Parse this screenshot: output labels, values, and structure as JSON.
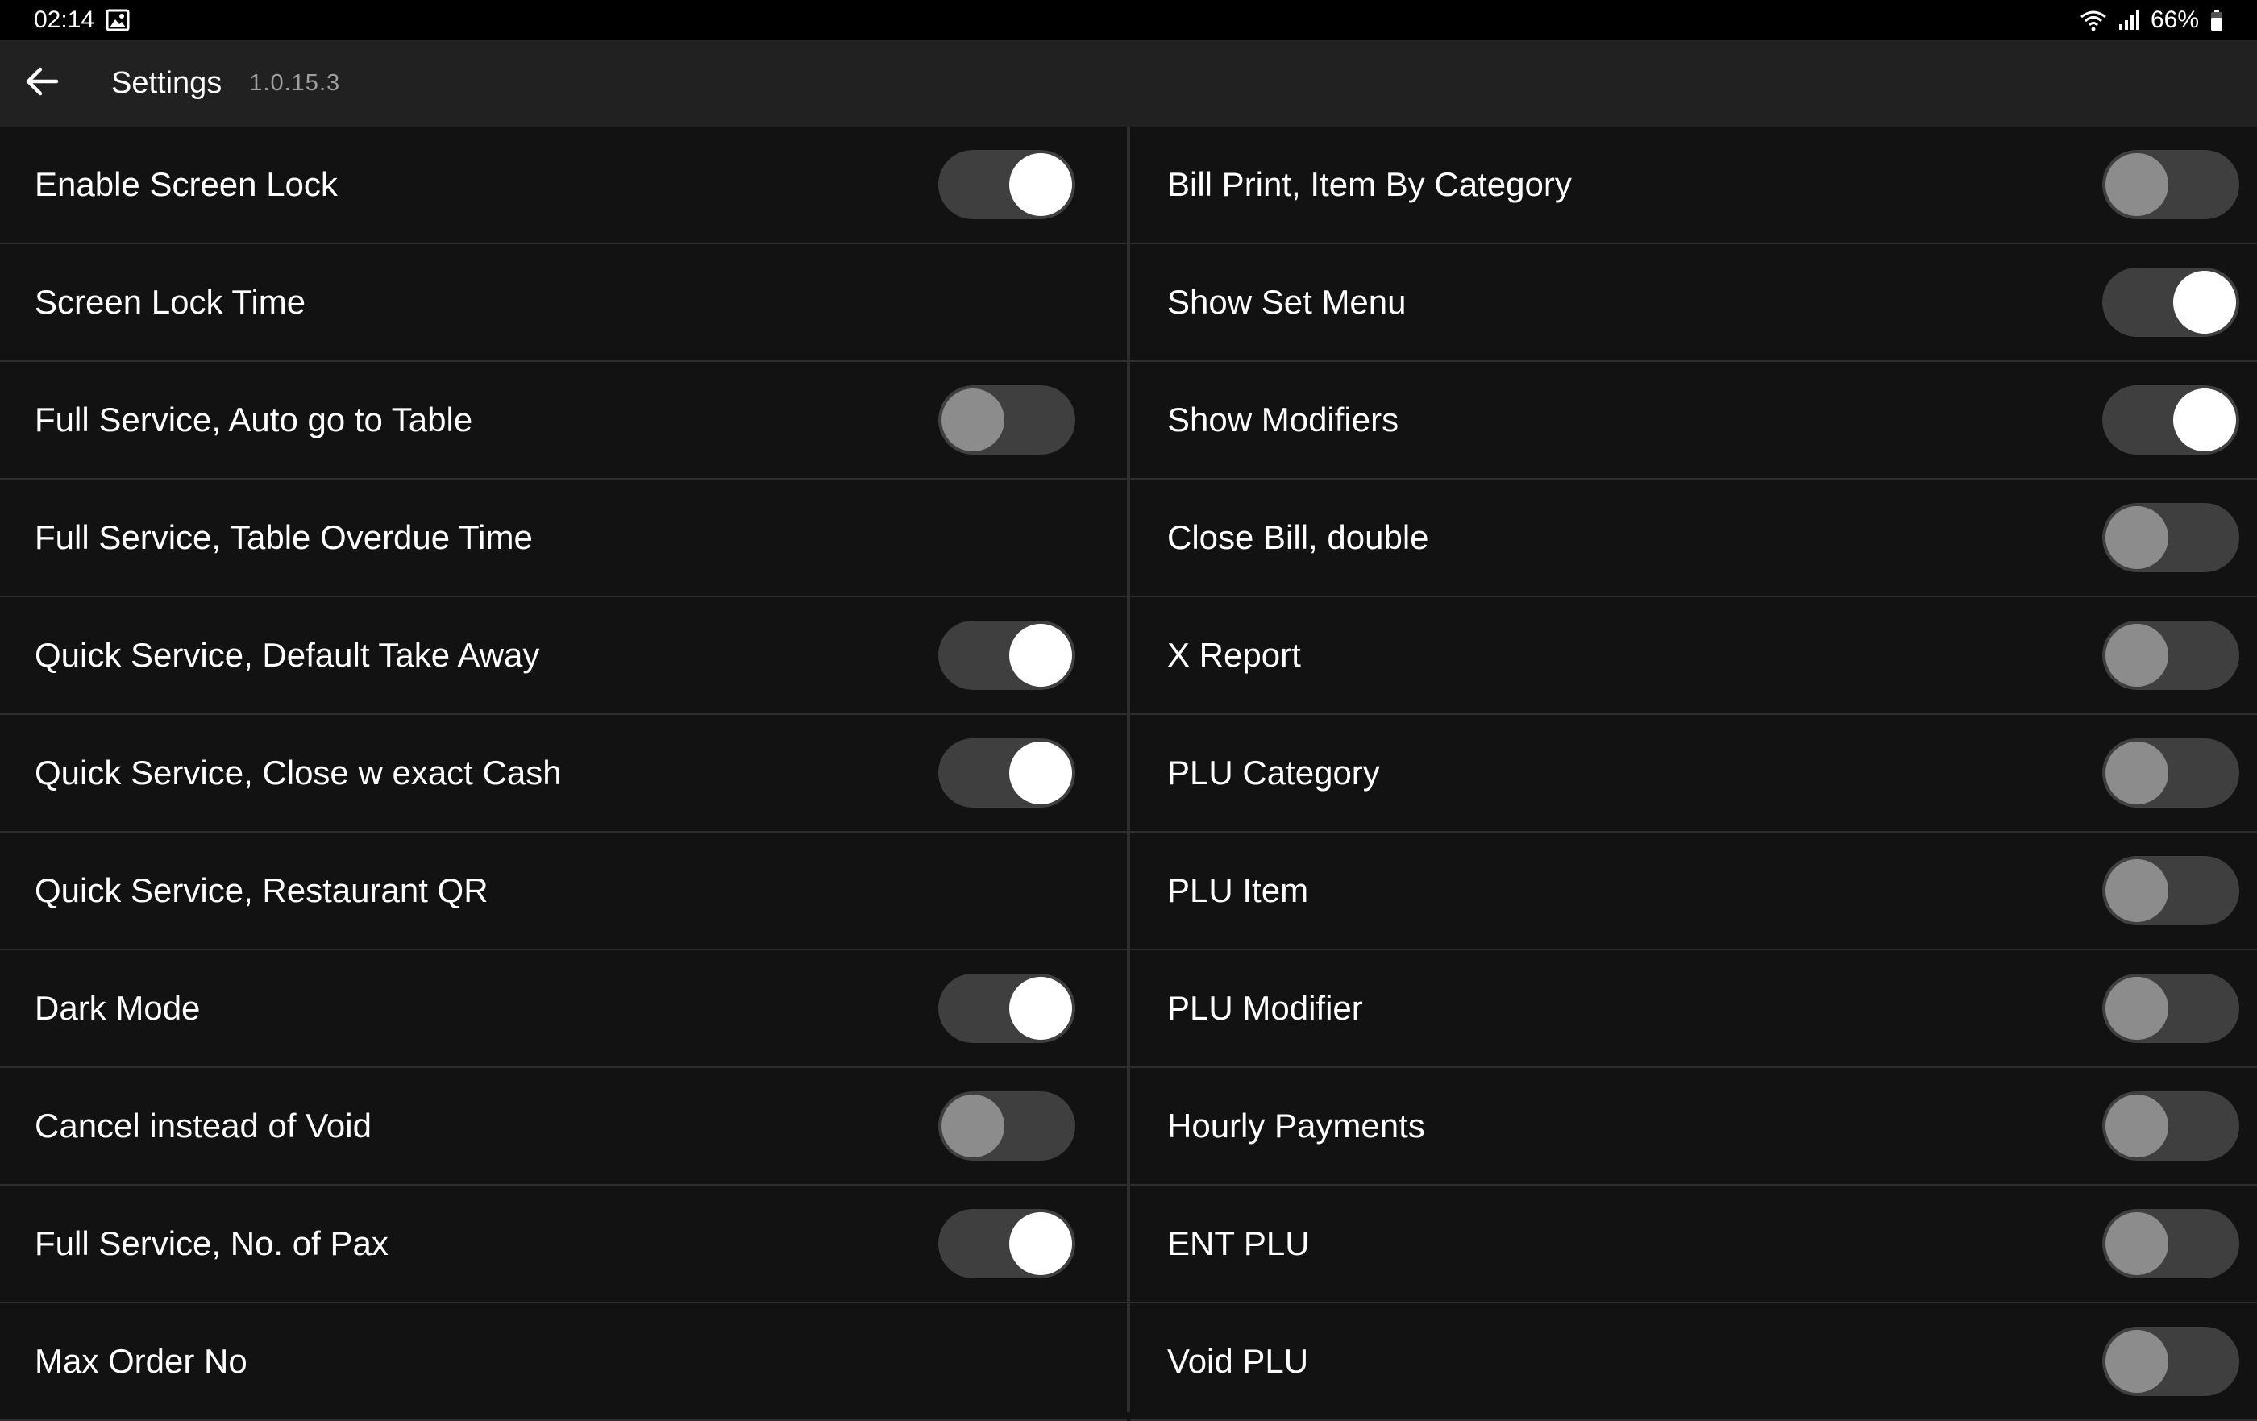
{
  "status_bar": {
    "time": "02:14",
    "battery": "66%",
    "icons": [
      "image-notification-icon",
      "wifi-icon",
      "signal-icon",
      "battery-icon"
    ]
  },
  "app_bar": {
    "title": "Settings",
    "version": "1.0.15.3",
    "back_icon": "arrow-left-icon"
  },
  "colors": {
    "background": "#121212",
    "app_bar": "#212121",
    "status_bar": "#000000",
    "divider": "#2e2e2e",
    "switch_track": "#3f3f3f",
    "switch_thumb_on": "#ffffff",
    "switch_thumb_off": "#8c8c8c"
  },
  "settings": {
    "left": [
      {
        "label": "Enable Screen Lock",
        "toggle": true,
        "on": true
      },
      {
        "label": "Screen Lock Time",
        "toggle": false
      },
      {
        "label": "Full Service, Auto go to Table",
        "toggle": true,
        "on": false
      },
      {
        "label": "Full Service, Table Overdue Time",
        "toggle": false
      },
      {
        "label": "Quick Service, Default Take Away",
        "toggle": true,
        "on": true
      },
      {
        "label": "Quick Service, Close w exact Cash",
        "toggle": true,
        "on": true
      },
      {
        "label": "Quick Service, Restaurant QR",
        "toggle": false
      },
      {
        "label": "Dark Mode",
        "toggle": true,
        "on": true
      },
      {
        "label": "Cancel instead of Void",
        "toggle": true,
        "on": false
      },
      {
        "label": "Full Service, No. of Pax",
        "toggle": true,
        "on": true
      },
      {
        "label": "Max Order No",
        "toggle": false
      }
    ],
    "right": [
      {
        "label": "Bill Print, Item By Category",
        "toggle": true,
        "on": false
      },
      {
        "label": "Show Set Menu",
        "toggle": true,
        "on": true
      },
      {
        "label": "Show Modifiers",
        "toggle": true,
        "on": true
      },
      {
        "label": "Close Bill, double",
        "toggle": true,
        "on": false
      },
      {
        "label": "X Report",
        "toggle": true,
        "on": false
      },
      {
        "label": "PLU Category",
        "toggle": true,
        "on": false
      },
      {
        "label": "PLU Item",
        "toggle": true,
        "on": false
      },
      {
        "label": "PLU Modifier",
        "toggle": true,
        "on": false
      },
      {
        "label": "Hourly Payments",
        "toggle": true,
        "on": false
      },
      {
        "label": "ENT PLU",
        "toggle": true,
        "on": false
      },
      {
        "label": "Void PLU",
        "toggle": true,
        "on": false
      }
    ]
  }
}
